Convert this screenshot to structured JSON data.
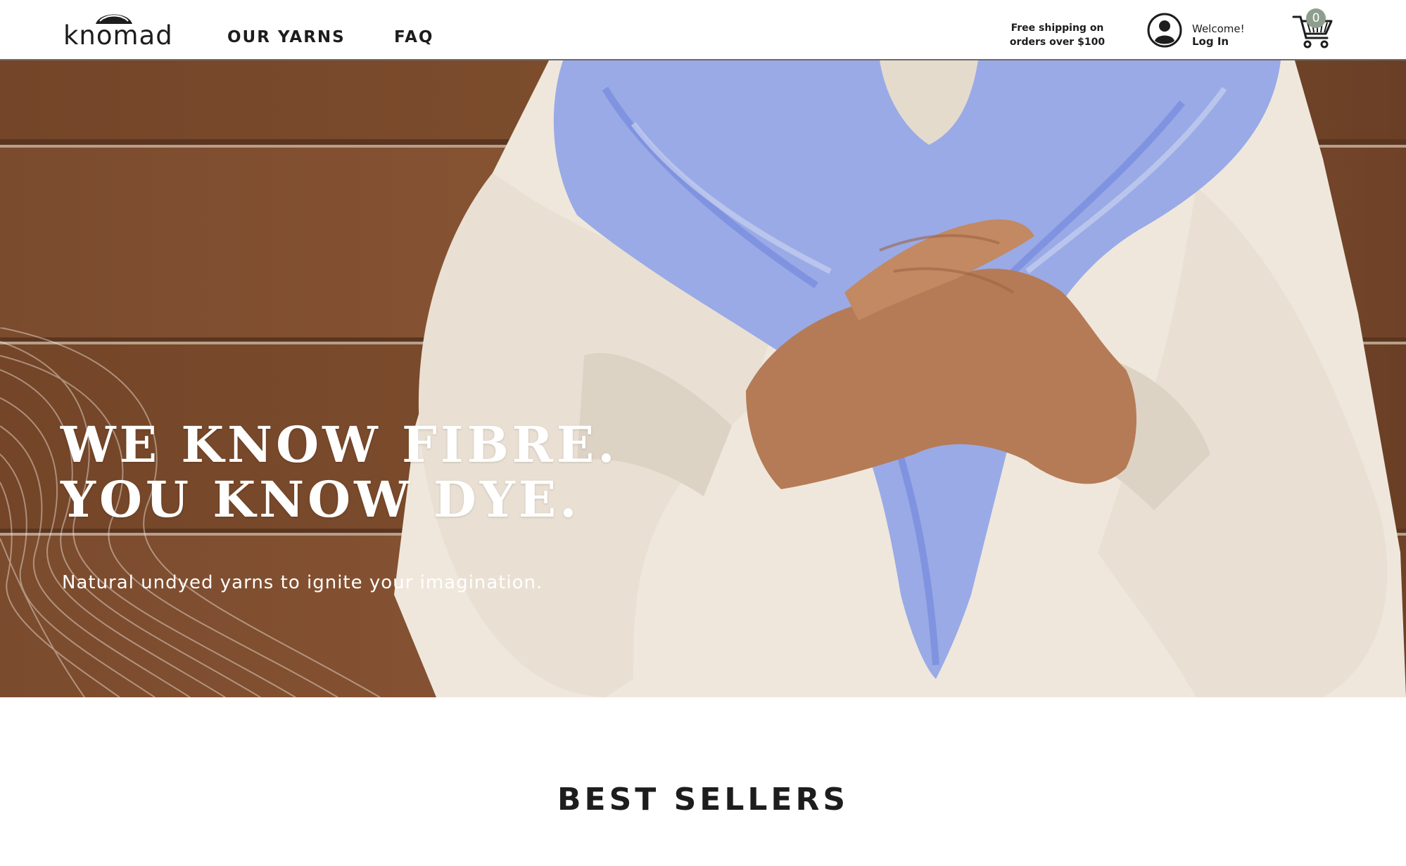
{
  "header": {
    "logo_text": "knomad",
    "nav": [
      {
        "label": "OUR YARNS"
      },
      {
        "label": "FAQ"
      }
    ],
    "shipping_line1": "Free shipping on",
    "shipping_line2": "orders over $100",
    "account": {
      "welcome": "Welcome!",
      "login": "Log In",
      "icon": "user-icon"
    },
    "cart": {
      "count": "0",
      "icon": "shopping-cart-icon"
    }
  },
  "hero": {
    "headline_line1": "WE KNOW FIBRE.",
    "headline_line2": "YOU KNOW DYE.",
    "tagline": "Natural undyed yarns to ignite your imagination."
  },
  "sections": {
    "best_sellers_title": "BEST SELLERS"
  },
  "colors": {
    "wood": "#7a4a2c",
    "sweater": "#efe7dc",
    "shawl": "#8d9ee6",
    "badge": "#8e9e8e",
    "text_dark": "#1d1d1d"
  }
}
